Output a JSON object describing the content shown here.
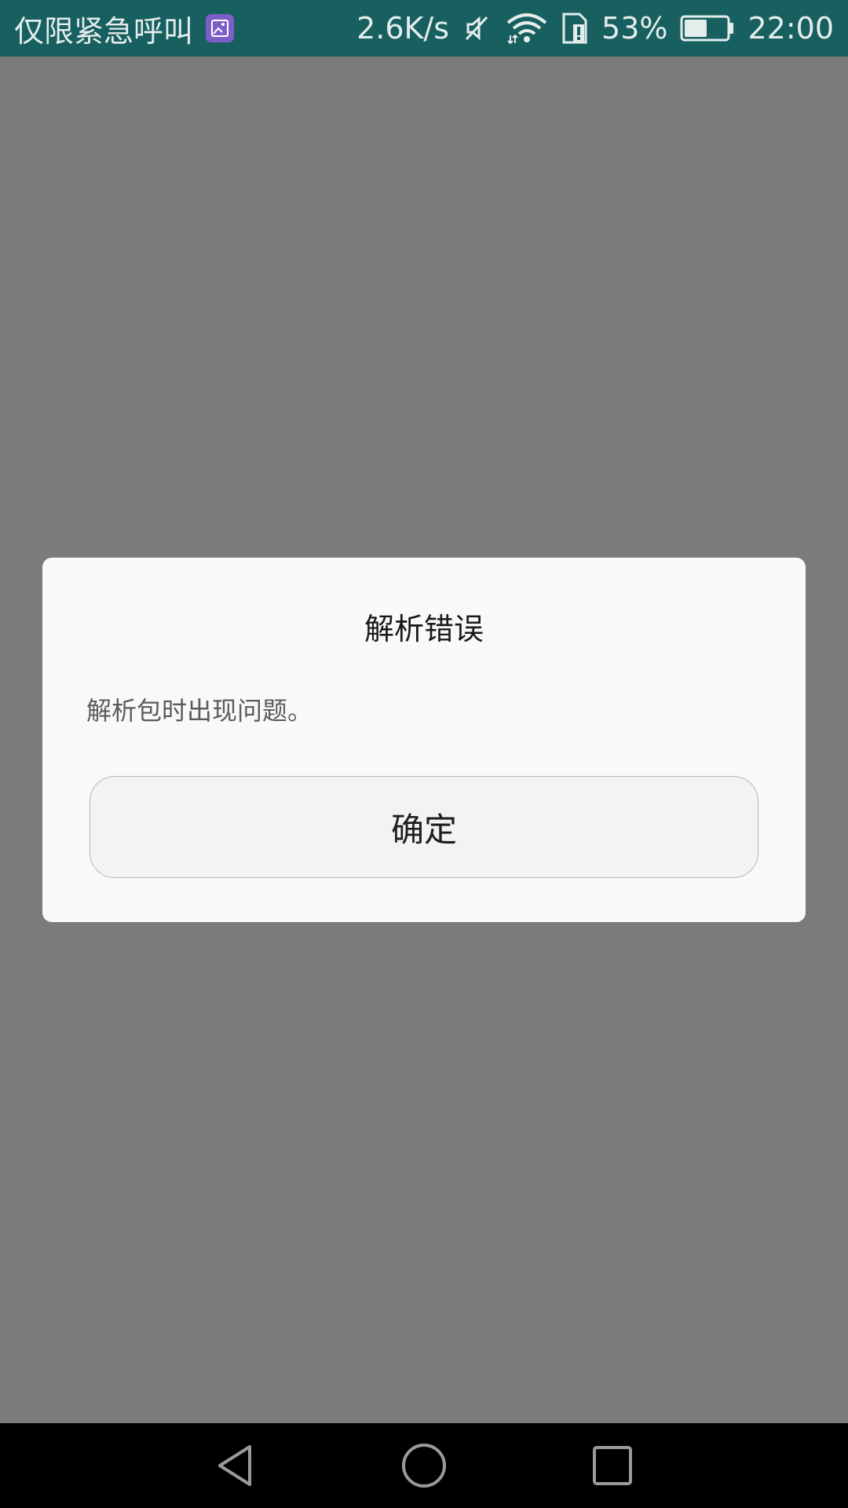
{
  "status_bar": {
    "carrier_text": "仅限紧急呼叫",
    "net_speed": "2.6K/s",
    "battery_percent": "53%",
    "battery_level": 0.53,
    "time": "22:00",
    "icons": [
      "image-notification-icon",
      "mute-icon",
      "wifi-icon",
      "sim-alert-icon",
      "battery-icon"
    ],
    "colors": {
      "background": "#17605f",
      "notification_icon": "#7d5ec8"
    }
  },
  "dialog": {
    "title": "解析错误",
    "message": "解析包时出现问题。",
    "ok_label": "确定"
  },
  "nav_bar": {
    "icons": [
      "back-icon",
      "home-icon",
      "recents-icon"
    ]
  },
  "colors": {
    "scrim": "#7b7b7b",
    "dialog_background": "#f9f9f9"
  }
}
